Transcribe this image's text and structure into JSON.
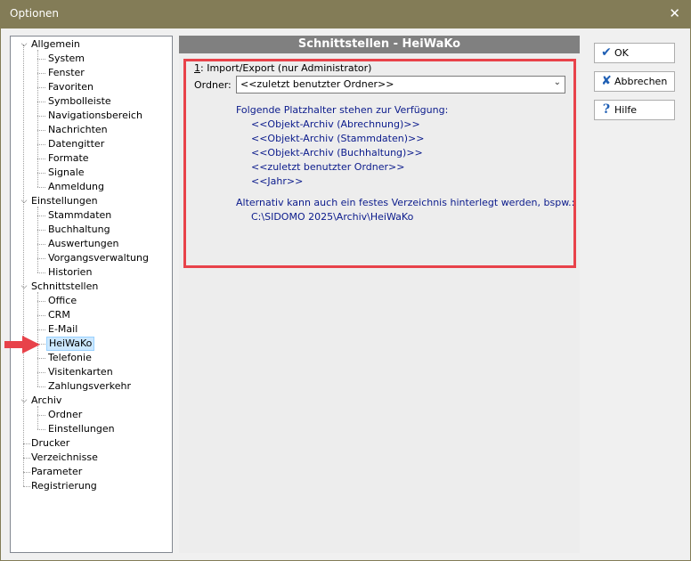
{
  "window": {
    "title": "Optionen",
    "close_glyph": "✕"
  },
  "tree": {
    "nodes": [
      {
        "label": "Allgemein",
        "level": 0,
        "expanded": true
      },
      {
        "label": "System",
        "level": 1
      },
      {
        "label": "Fenster",
        "level": 1
      },
      {
        "label": "Favoriten",
        "level": 1
      },
      {
        "label": "Symbolleiste",
        "level": 1
      },
      {
        "label": "Navigationsbereich",
        "level": 1
      },
      {
        "label": "Nachrichten",
        "level": 1
      },
      {
        "label": "Datengitter",
        "level": 1
      },
      {
        "label": "Formate",
        "level": 1
      },
      {
        "label": "Signale",
        "level": 1
      },
      {
        "label": "Anmeldung",
        "level": 1
      },
      {
        "label": "Einstellungen",
        "level": 0,
        "expanded": true
      },
      {
        "label": "Stammdaten",
        "level": 1
      },
      {
        "label": "Buchhaltung",
        "level": 1
      },
      {
        "label": "Auswertungen",
        "level": 1
      },
      {
        "label": "Vorgangsverwaltung",
        "level": 1
      },
      {
        "label": "Historien",
        "level": 1
      },
      {
        "label": "Schnittstellen",
        "level": 0,
        "expanded": true
      },
      {
        "label": "Office",
        "level": 1
      },
      {
        "label": "CRM",
        "level": 1
      },
      {
        "label": "E-Mail",
        "level": 1
      },
      {
        "label": "HeiWaKo",
        "level": 1,
        "selected": true
      },
      {
        "label": "Telefonie",
        "level": 1
      },
      {
        "label": "Visitenkarten",
        "level": 1
      },
      {
        "label": "Zahlungsverkehr",
        "level": 1
      },
      {
        "label": "Archiv",
        "level": 0,
        "expanded": true
      },
      {
        "label": "Ordner",
        "level": 1
      },
      {
        "label": "Einstellungen",
        "level": 1
      },
      {
        "label": "Drucker",
        "level": 0
      },
      {
        "label": "Verzeichnisse",
        "level": 0
      },
      {
        "label": "Parameter",
        "level": 0
      },
      {
        "label": "Registrierung",
        "level": 0
      }
    ]
  },
  "content": {
    "header": "Schnittstellen - HeiWaKo",
    "group_title_key": "1",
    "group_title_rest": ": Import/Export  (nur Administrator)",
    "ordner_label": "Ordner:",
    "ordner_value": "<<zuletzt benutzter Ordner>>",
    "placeholders_intro": "Folgende Platzhalter stehen zur Verfügung:",
    "placeholders": [
      "<<Objekt-Archiv (Abrechnung)>>",
      "<<Objekt-Archiv (Stammdaten)>>",
      "<<Objekt-Archiv (Buchhaltung)>>",
      "<<zuletzt benutzter Ordner>>",
      "<<Jahr>>"
    ],
    "alt_intro": "Alternativ kann auch ein festes Verzeichnis hinterlegt werden, bspw.:",
    "alt_example": "C:\\SIDOMO 2025\\Archiv\\HeiWaKo"
  },
  "buttons": {
    "ok": "OK",
    "cancel": "Abbrechen",
    "help": "Hilfe"
  },
  "colors": {
    "titlebar": "#837c57",
    "highlight_box": "#e8424a",
    "info_text": "#0b1b8c",
    "arrow": "#e8424a"
  }
}
